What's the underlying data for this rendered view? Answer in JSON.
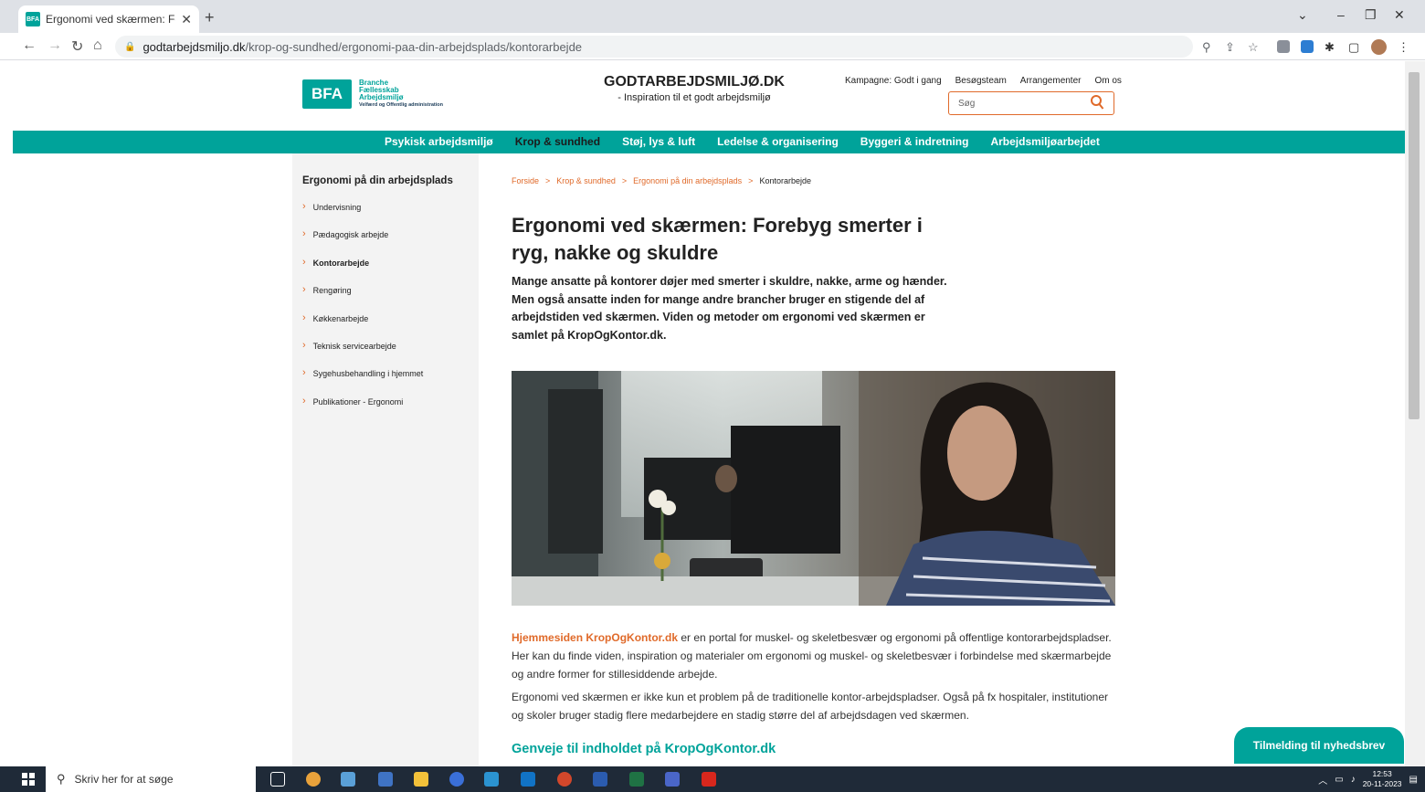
{
  "browser": {
    "tab_title": "Ergonomi ved skærmen: Foreby",
    "url_host": "godtarbejdsmiljo.dk",
    "url_path": "/krop-og-sundhed/ergonomi-paa-din-arbejdsplads/kontorarbejde"
  },
  "site": {
    "logo_text": "BFA",
    "logo_line1": "Branche",
    "logo_line2": "Fællesskab",
    "logo_line3": "Arbejdsmiljø",
    "logo_line4": "Velfærd og Offentlig administration",
    "title": "GODTARBEJDSMILJØ.DK",
    "tagline": "- Inspiration til et godt arbejdsmiljø",
    "top_links": [
      "Kampagne: Godt i gang",
      "Besøgsteam",
      "Arrangementer",
      "Om os"
    ],
    "search_placeholder": "Søg"
  },
  "main_nav": [
    {
      "label": "Psykisk arbejdsmiljø",
      "active": false
    },
    {
      "label": "Krop & sundhed",
      "active": true
    },
    {
      "label": "Støj, lys & luft",
      "active": false
    },
    {
      "label": "Ledelse & organisering",
      "active": false
    },
    {
      "label": "Byggeri & indretning",
      "active": false
    },
    {
      "label": "Arbejdsmiljøarbejdet",
      "active": false
    }
  ],
  "sidebar": {
    "heading": "Ergonomi på din arbejdsplads",
    "items": [
      {
        "label": "Undervisning"
      },
      {
        "label": "Pædagogisk arbejde"
      },
      {
        "label": "Kontorarbejde"
      },
      {
        "label": "Rengøring"
      },
      {
        "label": "Køkkenarbejde"
      },
      {
        "label": "Teknisk servicearbejde"
      },
      {
        "label": "Sygehusbehandling i hjemmet"
      },
      {
        "label": "Publikationer - Ergonomi"
      }
    ]
  },
  "breadcrumb": [
    "Forside",
    "Krop & sundhed",
    "Ergonomi på din arbejdsplads",
    "Kontorarbejde"
  ],
  "article": {
    "title": "Ergonomi ved skærmen: Forebyg smerter i ryg, nakke og skuldre",
    "lead": "Mange ansatte på kontorer døjer med smerter i skuldre, nakke, arme og hænder. Men også ansatte inden for mange andre brancher bruger en stigende del af arbejdstiden ved skærmen. Viden og metoder om ergonomi ved skærmen er samlet på KropOgKontor.dk.",
    "p1_link": "Hjemmesiden KropOgKontor.dk",
    "p1_text": " er en portal for muskel- og skeletbesvær og ergonomi på offentlige kontorarbejdspladser. Her kan du finde viden, inspiration og materialer om ergonomi og muskel- og skeletbesvær i forbindelse med skærmarbejde og andre former for stillesiddende arbejde.",
    "p2": "Ergonomi ved skærmen er ikke kun et problem på de traditionelle kontor-arbejdspladser. Også på fx hospitaler, institutioner og skoler bruger stadig flere medarbejdere en stadig større del af arbejdsdagen ved skærmen.",
    "h2": "Genveje til indholdet på KropOgKontor.dk"
  },
  "newsletter_label": "Tilmelding til nyhedsbrev",
  "taskbar": {
    "search_placeholder": "Skriv her for at søge",
    "time": "12:53",
    "date": "20-11-2023"
  },
  "colors": {
    "teal": "#00a39a",
    "orange": "#e06a2a"
  }
}
